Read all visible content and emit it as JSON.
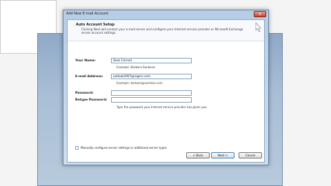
{
  "dialog": {
    "title": "Add New E-mail Account",
    "close_glyph": "x"
  },
  "header": {
    "title": "Auto Account Setup",
    "description": "Clicking Next will contact your e-mail server and configure your Internet service provider or Microsoft Exchange server account settings."
  },
  "form": {
    "your_name_label": "Your Name:",
    "your_name_value": "Sean Conrad",
    "your_name_hint": "Example: Barbara Sankovic",
    "email_label": "E-mail Address:",
    "email_value": "outlook2007@rogers.com",
    "email_hint": "Example: barbara@contoso.com",
    "password_label": "Password:",
    "retype_label": "Retype Password:",
    "password_hint": "Type the password your Internet service provider has given you."
  },
  "manual": {
    "label": "Manually configure server settings or additional server types"
  },
  "buttons": {
    "back": "< Back",
    "next": "Next >",
    "cancel": "Cancel"
  },
  "colors": {
    "accent": "#3c7fb1",
    "dialog_frame": "#b7cde6",
    "close_button": "#c8412a"
  }
}
